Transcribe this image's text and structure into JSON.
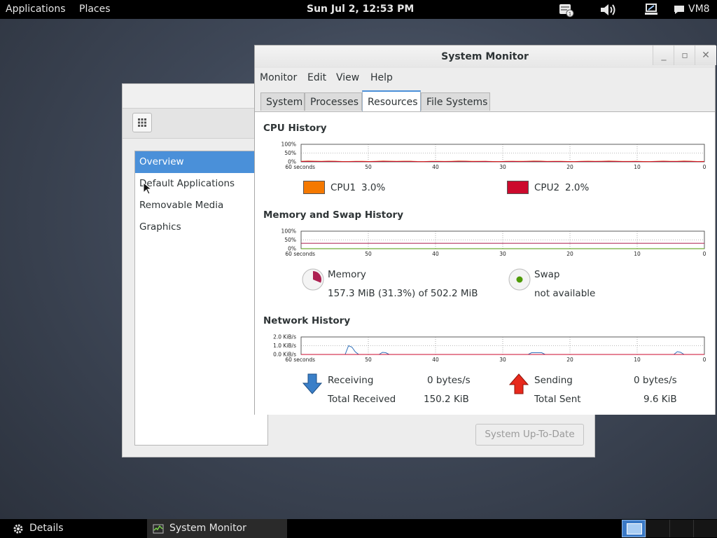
{
  "top_panel": {
    "applications": "Applications",
    "places": "Places",
    "clock": "Sun Jul  2, 12:53 PM",
    "user": "VM8",
    "tray_icons": [
      "notification-icon",
      "volume-icon",
      "network-icon",
      "chat-icon"
    ]
  },
  "details_window": {
    "sidebar": [
      {
        "label": "Overview",
        "selected": true
      },
      {
        "label": "Default Applications",
        "selected": false
      },
      {
        "label": "Removable Media",
        "selected": false
      },
      {
        "label": "Graphics",
        "selected": false
      }
    ],
    "update_button": "System Up-To-Date"
  },
  "system_monitor": {
    "title": "System Monitor",
    "menu": [
      "Monitor",
      "Edit",
      "View",
      "Help"
    ],
    "tabs": [
      {
        "label": "System",
        "active": false
      },
      {
        "label": "Processes",
        "active": false
      },
      {
        "label": "Resources",
        "active": true
      },
      {
        "label": "File Systems",
        "active": false
      }
    ],
    "x_ticks": [
      "60 seconds",
      "50",
      "40",
      "30",
      "20",
      "10",
      "0"
    ],
    "cpu": {
      "title": "CPU History",
      "y_ticks": [
        "100%",
        "50%",
        "0%"
      ],
      "cpu1_label": "CPU1",
      "cpu1_value": "3.0%",
      "cpu1_color": "#f57900",
      "cpu2_label": "CPU2",
      "cpu2_value": "2.0%",
      "cpu2_color": "#cc0a2d",
      "cpu1_percent": 3.0,
      "cpu2_percent": 2.0
    },
    "memory": {
      "title": "Memory and Swap History",
      "y_ticks": [
        "100%",
        "50%",
        "0%"
      ],
      "mem_label": "Memory",
      "mem_value": "157.3 MiB (31.3%) of 502.2 MiB",
      "mem_percent": 31.3,
      "mem_color": "#ad2152",
      "swap_label": "Swap",
      "swap_value": "not available",
      "swap_color": "#4e9a06"
    },
    "network": {
      "title": "Network History",
      "y_ticks": [
        "2.0 KiB/s",
        "1.0 KiB/s",
        "0.0 KiB/s"
      ],
      "receiving_label": "Receiving",
      "receiving_value": "0 bytes/s",
      "total_received_label": "Total Received",
      "total_received_value": "150.2 KiB",
      "sending_label": "Sending",
      "sending_value": "0 bytes/s",
      "total_sent_label": "Total Sent",
      "total_sent_value": "9.6 KiB",
      "receive_color": "#2f6fb8",
      "send_color": "#cc0a2d"
    }
  },
  "bottom_panel": {
    "details_task": "Details",
    "monitor_task": "System Monitor"
  }
}
